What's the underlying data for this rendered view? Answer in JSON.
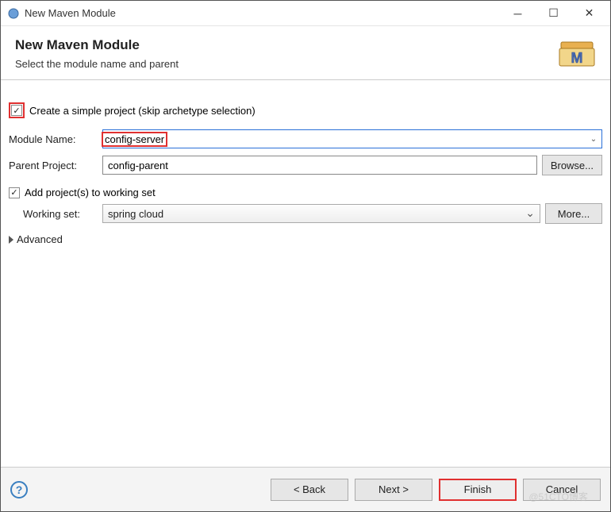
{
  "titlebar": {
    "title": "New Maven Module"
  },
  "header": {
    "title": "New Maven Module",
    "subtitle": "Select the module name and parent"
  },
  "form": {
    "simple_project_label": "Create a simple project (skip archetype selection)",
    "simple_project_checked": true,
    "module_name_label": "Module Name:",
    "module_name_value": "config-server",
    "parent_project_label": "Parent Project:",
    "parent_project_value": "config-parent",
    "browse_label": "Browse...",
    "add_working_set_label": "Add project(s) to working set",
    "add_working_set_checked": true,
    "working_set_label": "Working set:",
    "working_set_value": "spring cloud",
    "more_label": "More...",
    "advanced_label": "Advanced"
  },
  "footer": {
    "back_label": "< Back",
    "next_label": "Next >",
    "finish_label": "Finish",
    "cancel_label": "Cancel"
  },
  "watermark": "@51CTO博客"
}
